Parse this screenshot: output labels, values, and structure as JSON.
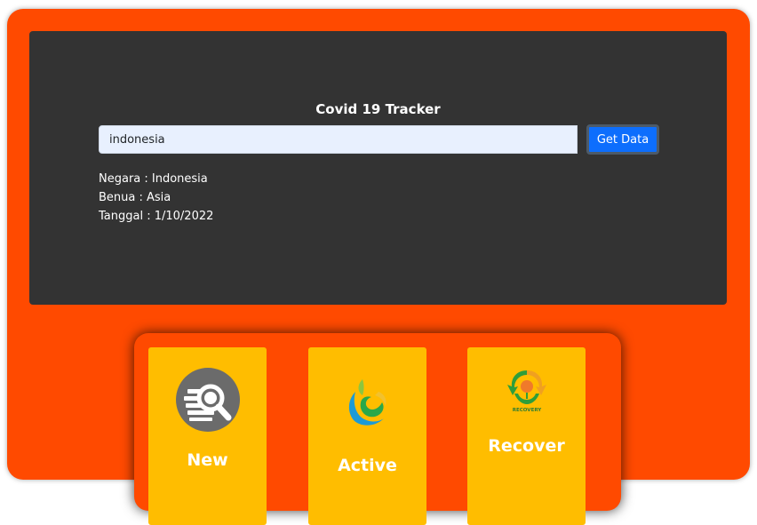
{
  "header": {
    "title": "Covid 19 Tracker"
  },
  "search": {
    "value": "indonesia",
    "button_label": "Get Data"
  },
  "info": {
    "negara": "Negara : Indonesia",
    "benua": "Benua : Asia",
    "tanggal": "Tanggal : 1/10/2022"
  },
  "cards": [
    {
      "label": "New",
      "icon": "magnifier-data-icon"
    },
    {
      "label": "Active",
      "icon": "leaf-swirl-icon"
    },
    {
      "label": "Recover",
      "icon": "recovery-icon",
      "logo_text": "RECOVERY"
    }
  ],
  "colors": {
    "background": "#ff4a00",
    "panel": "#333333",
    "card": "#ffbd00",
    "button": "#0d6efd",
    "input": "#e8f0fe"
  }
}
